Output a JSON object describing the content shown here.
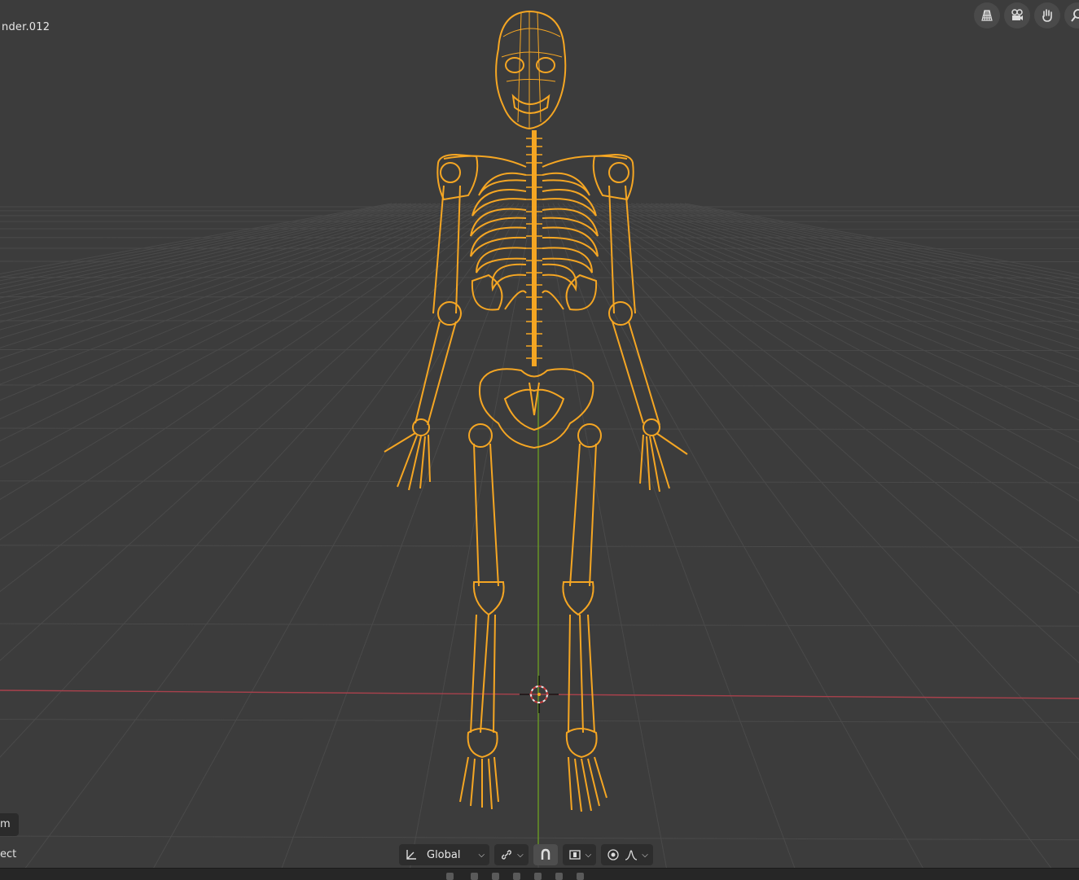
{
  "viewport": {
    "object_name": "nder.012",
    "background_color": "#3c3c3c",
    "grid_color": "#4a4a4a",
    "x_axis_color": "#a8414c",
    "y_axis_color": "#6a9a23",
    "selection_color": "#f5a623"
  },
  "navigation_gizmos": [
    {
      "name": "grid-view-icon"
    },
    {
      "name": "camera-icon"
    },
    {
      "name": "hand-pan-icon"
    },
    {
      "name": "zoom-icon"
    }
  ],
  "left_tools": {
    "top_label": "m",
    "bottom_label": "ect"
  },
  "header": {
    "transform_orientation": "Global",
    "pivot_icon": "link-icon",
    "snap_icon": "magnet-icon",
    "snap_target_icon": "snap-target-icon",
    "proportional_icon": "proportional-editing-icon",
    "falloff_icon": "falloff-curve-icon"
  }
}
